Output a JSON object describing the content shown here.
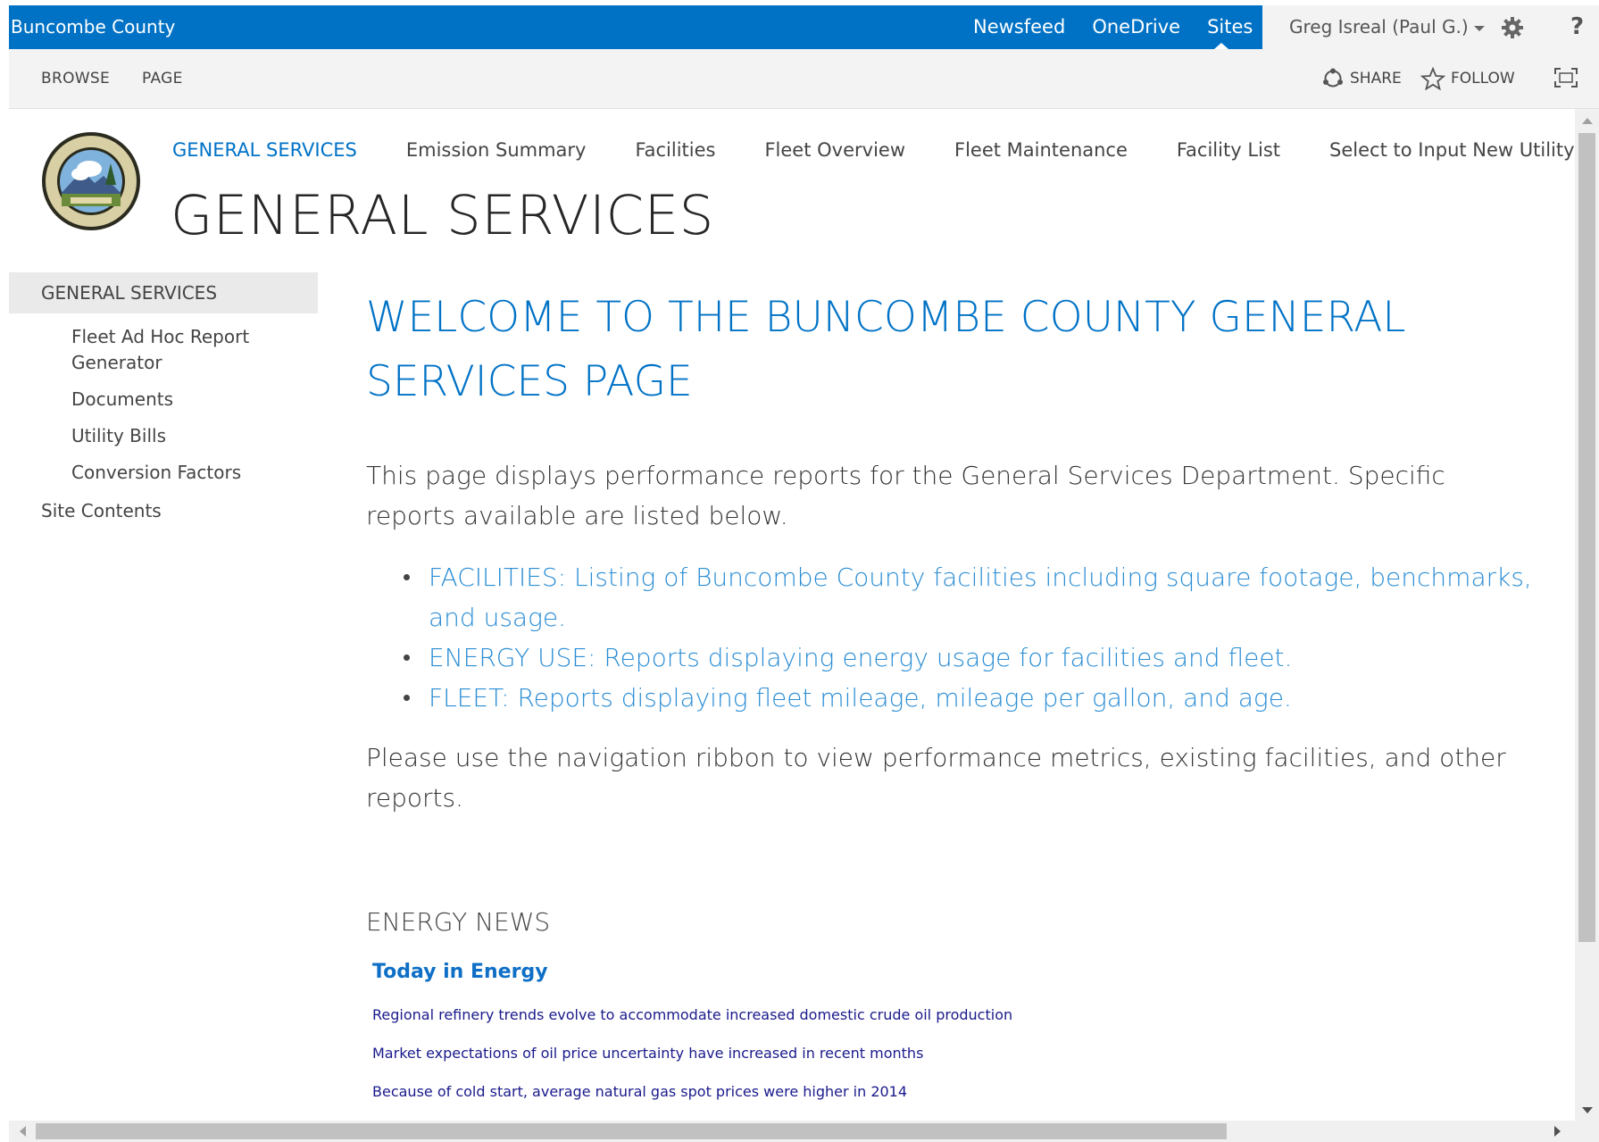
{
  "suite_bar": {
    "brand": "Buncombe County",
    "links": [
      "Newsfeed",
      "OneDrive",
      "Sites"
    ],
    "active_link": "Sites",
    "user": "Greg Isreal (Paul G.)",
    "help": "?"
  },
  "ribbon": {
    "tabs": [
      "BROWSE",
      "PAGE"
    ],
    "share_label": "SHARE",
    "follow_label": "FOLLOW"
  },
  "header": {
    "top_nav": [
      "GENERAL SERVICES",
      "Emission Summary",
      "Facilities",
      "Fleet Overview",
      "Fleet Maintenance",
      "Facility List",
      "Select to Input New Utility Bill"
    ],
    "site_title": "GENERAL SERVICES"
  },
  "left_nav": {
    "heading": "GENERAL SERVICES",
    "items": [
      "Fleet Ad Hoc Report Generator",
      "Documents",
      "Utility Bills",
      "Conversion Factors"
    ],
    "site_contents": "Site Contents"
  },
  "main": {
    "welcome": "WELCOME TO THE BUNCOMBE COUNTY GENERAL SERVICES PAGE",
    "intro": "This page displays performance reports for the General Services Department. Specific reports available are listed below.",
    "bullets": [
      "FACILITIES: Listing of Buncombe County facilities including square footage, benchmarks, and usage.",
      "ENERGY USE: Reports displaying energy usage for facilities and fleet.",
      "FLEET: Reports displaying fleet mileage, mileage per gallon, and age."
    ],
    "outro": "Please use the navigation ribbon to view performance metrics, existing facilities, and other reports.",
    "news_heading": "ENERGY NEWS",
    "news_title": "Today in Energy",
    "news_items": [
      "Regional refinery trends evolve to accommodate increased domestic crude oil production",
      "Market expectations of oil price uncertainty have increased in recent months",
      "Because of cold start, average natural gas spot prices were higher in 2014"
    ]
  },
  "colors": {
    "suite_bar": "#0072c6",
    "accent": "#0072c6",
    "link": "#2a8dd4"
  }
}
